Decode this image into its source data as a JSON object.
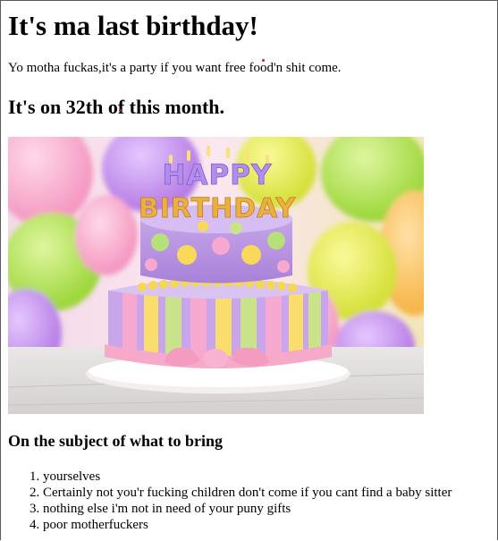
{
  "page": {
    "heading": "It's ma last birthday!",
    "intro": "Yo motha fuckas,it's a party if you want free food'n shit come.",
    "date_line": "It's on 32th of this month.",
    "bring_heading": "On the subject of what to bring",
    "bring_items": [
      "yourselves",
      "Certainly not you'r fucking children don't come if you cant find a baby sitter",
      "nothing else i'm not in need of your puny gifts",
      "poor motherfuckers"
    ]
  },
  "image": {
    "topper": [
      "HAPPY",
      "BIRTHDAY"
    ]
  },
  "colors": {
    "accent_dot": "#cc1b1b"
  }
}
